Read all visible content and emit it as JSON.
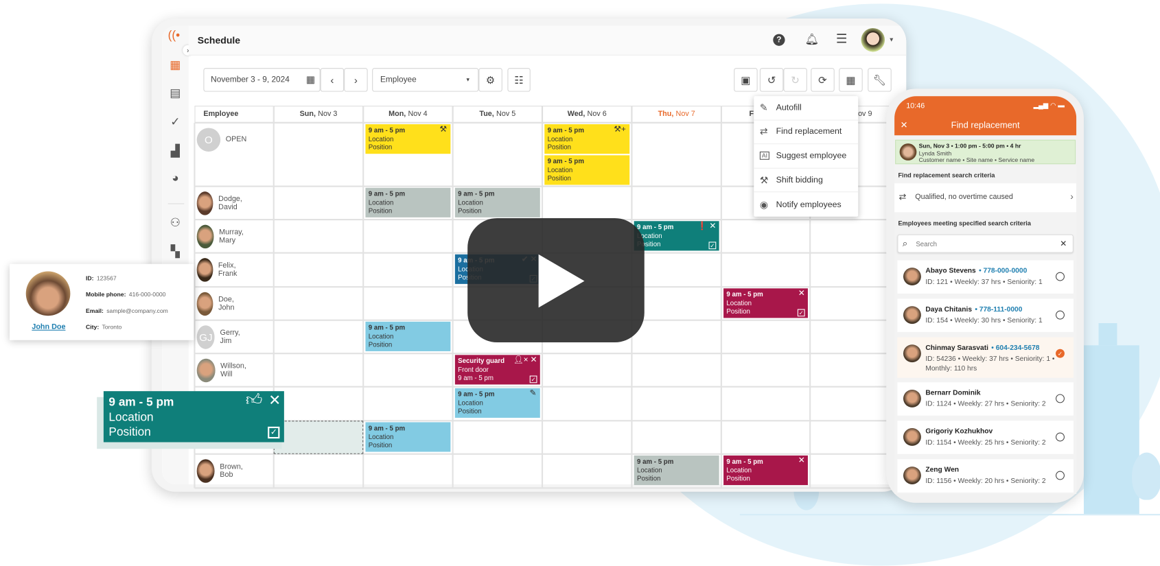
{
  "app": {
    "title": "Schedule"
  },
  "header": {
    "icons": [
      "help-icon",
      "bell-icon",
      "list-icon",
      "user-avatar"
    ]
  },
  "sidebar": {
    "items": [
      "schedule-grid",
      "calendar-clock",
      "tasks",
      "reports",
      "analytics",
      "employees",
      "locations"
    ]
  },
  "toolbar": {
    "date_range": "November 3 - 9, 2024",
    "view_select": "Employee",
    "right_buttons": [
      "save",
      "undo",
      "redo",
      "refresh",
      "calendar-edit",
      "tools"
    ]
  },
  "grid": {
    "employee_header": "Employee",
    "days": [
      {
        "dow": "Sun,",
        "date": "Nov 3"
      },
      {
        "dow": "Mon,",
        "date": "Nov 4"
      },
      {
        "dow": "Tue,",
        "date": "Nov 5"
      },
      {
        "dow": "Wed,",
        "date": "Nov 6"
      },
      {
        "dow": "Thu,",
        "date": "Nov 7",
        "today": true
      },
      {
        "dow": "Fri,",
        "date": "Nov 8"
      },
      {
        "dow": "Sat,",
        "date": "Nov 9"
      }
    ],
    "employees": [
      {
        "name": "OPEN",
        "initials": "O"
      },
      {
        "name": "Dodge, David"
      },
      {
        "name": "Murray, Mary"
      },
      {
        "name": "Felix, Frank"
      },
      {
        "name": "Doe, John"
      },
      {
        "name": "Gerry, Jim",
        "initials": "GJ"
      },
      {
        "name": "Willson, Will"
      },
      {
        "name": ""
      },
      {
        "name": ""
      },
      {
        "name": "Brown, Bob"
      }
    ],
    "shifts": [
      {
        "row": 0,
        "day": 1,
        "color": "#ffe01b",
        "lines": [
          "9 am - 5 pm",
          "Location",
          "Position"
        ],
        "icon": "gavel-icon"
      },
      {
        "row": 0,
        "day": 3,
        "color": "#ffe01b",
        "lines": [
          "9 am - 5 pm",
          "Location",
          "Position"
        ],
        "icon": "gavel-plus-icon"
      },
      {
        "row": 0,
        "day": 3,
        "stack": 1,
        "color": "#ffe01b",
        "lines": [
          "9 am - 5 pm",
          "Location",
          "Position"
        ]
      },
      {
        "row": 1,
        "day": 1,
        "color": "#b9c4c0",
        "lines": [
          "9 am - 5 pm",
          "Location",
          "Position"
        ]
      },
      {
        "row": 1,
        "day": 2,
        "color": "#b9c4c0",
        "lines": [
          "9 am - 5 pm",
          "Location",
          "Position"
        ]
      },
      {
        "row": 2,
        "day": 4,
        "color": "#0f7f7a",
        "light": true,
        "lines": [
          "9 am - 5 pm",
          "Location",
          "Position"
        ],
        "icon": "alert-icon",
        "close": true,
        "check": true
      },
      {
        "row": 3,
        "day": 2,
        "color": "#1b6fa0",
        "light": true,
        "lines": [
          "9 am - 5 pm",
          "Location",
          "Position"
        ],
        "icon": "check-circle-icon",
        "close": true,
        "check": true
      },
      {
        "row": 4,
        "day": 5,
        "color": "#a8174a",
        "light": true,
        "lines": [
          "9 am - 5 pm",
          "Location",
          "Position"
        ],
        "close": true,
        "check": true
      },
      {
        "row": 5,
        "day": 1,
        "color": "#82cbe3",
        "lines": [
          "9 am - 5 pm",
          "Location",
          "Position"
        ]
      },
      {
        "row": 6,
        "day": 2,
        "color": "#a8174a",
        "light": true,
        "lines": [
          "Security guard",
          "Front door",
          "9 am - 5 pm"
        ],
        "icon": "person-remove-icon",
        "close": true,
        "check": true
      },
      {
        "row": 7,
        "day": 2,
        "color": "#82cbe3",
        "lines": [
          "9 am - 5 pm",
          "Location",
          "Position"
        ],
        "icon": "edit-icon"
      },
      {
        "row": 8,
        "day": 1,
        "color": "#82cbe3",
        "lines": [
          "9 am - 5 pm",
          "Location",
          "Position"
        ]
      },
      {
        "row": 9,
        "day": 4,
        "color": "#b9c4c0",
        "lines": [
          "9 am - 5 pm",
          "Location",
          "Position"
        ]
      },
      {
        "row": 9,
        "day": 5,
        "color": "#a8174a",
        "light": true,
        "lines": [
          "9 am - 5 pm",
          "Location",
          "Position"
        ],
        "close": true
      }
    ]
  },
  "tools_menu": {
    "items": [
      {
        "label": "Autofill",
        "icon": "magic-wand-icon"
      },
      {
        "label": "Find replacement",
        "icon": "swap-icon"
      },
      {
        "label": "Suggest employee",
        "icon": "ai-chip-icon"
      },
      {
        "label": "Shift bidding",
        "icon": "gavel-icon"
      },
      {
        "label": "Notify employees",
        "icon": "broadcast-icon"
      }
    ]
  },
  "profile_card": {
    "name": "John Doe",
    "fields": [
      {
        "label": "ID:",
        "value": "123567"
      },
      {
        "label": "Mobile phone:",
        "value": "416-000-0000"
      },
      {
        "label": "Email:",
        "value": "sample@company.com"
      },
      {
        "label": "City:",
        "value": "Toronto"
      }
    ]
  },
  "drag_shift": {
    "time": "9 am - 5 pm",
    "location": "Location",
    "position": "Position"
  },
  "phone": {
    "time": "10:46",
    "title": "Find replacement",
    "shift_card": {
      "line1": "Sun, Nov 3 • 1:00 pm - 5:00 pm • 4 hr",
      "name": "Lynda Smith",
      "details": "Customer name • Site name • Service name"
    },
    "criteria_heading": "Find replacement search criteria",
    "criteria_value": "Qualified, no overtime caused",
    "list_heading": "Employees meeting specified search criteria",
    "search_placeholder": "Search",
    "candidates": [
      {
        "name": "Abayo Stevens",
        "phone": "• 778-000-0000",
        "meta": "ID: 121  • Weekly: 37 hrs • Seniority: 1",
        "selected": false
      },
      {
        "name": "Daya Chitanis",
        "phone": "• 778-111-0000",
        "meta": "ID: 154  • Weekly: 30 hrs • Seniority: 1",
        "selected": false
      },
      {
        "name": "Chinmay Sarasvati",
        "phone": "• 604-234-5678",
        "meta": "ID: 54236 • Weekly: 37 hrs • Seniority: 1 • Monthly: 110 hrs",
        "selected": true
      },
      {
        "name": "Bernarr Dominik",
        "phone": "",
        "meta": "ID: 1124  • Weekly: 27 hrs • Seniority: 2",
        "selected": false
      },
      {
        "name": "Grigoriy Kozhukhov",
        "phone": "",
        "meta": "ID: 1154  • Weekly: 25 hrs • Seniority: 2",
        "selected": false
      },
      {
        "name": "Zeng Wen",
        "phone": "",
        "meta": "ID: 1156  • Weekly: 20 hrs • Seniority: 2",
        "selected": false
      }
    ]
  },
  "colors": {
    "accent": "#e8692a",
    "teal": "#0f7f7a",
    "link": "#1f7fb0"
  }
}
